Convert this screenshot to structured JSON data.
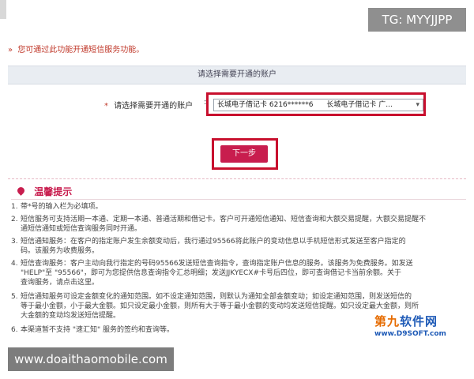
{
  "overlays": {
    "tg_badge": "TG: MYYJJPP",
    "site_badge": "www.doaithaomobile.com"
  },
  "notice": {
    "marker": "»",
    "text": "您可通过此功能开通短信服务功能。"
  },
  "section": {
    "title": "请选择需要开通的账户"
  },
  "account": {
    "required_mark": "*",
    "label": "请选择需要开通的账户",
    "colon": ":",
    "selected_card": "长城电子借记卡 6216******6",
    "selected_card_type": "长城电子借记卡 广...",
    "arrow": "▾"
  },
  "actions": {
    "next_label": "下一步"
  },
  "tips": {
    "title": "温馨提示",
    "items": [
      {
        "num": "1.",
        "text": "带*号的输入栏为必填项。"
      },
      {
        "num": "2.",
        "text": "短信服务可支持活期一本通、定期一本通、普通活期和借记卡。客户可开通短信通知、短信查询和大额交易提醒，大额交易提醒不",
        "text2": "通短信通知或短信查询服务同时开通。"
      },
      {
        "num": "3.",
        "text": "短信通知服务：在客户的指定账户发生余额变动后，我行通过95566将此账户的变动信息以手机短信形式发送至客户指定的",
        "text2": "码。该服务为收费服务。"
      },
      {
        "num": "4.",
        "text": "短信查询服务：客户主动向我行指定的号码95566发送短信查询指令，查询指定账户信息的服务。该服务为免费服务。如发送",
        "text2": "\"HELP\"至 \"95566\"，即可为您提供信息查询指令汇总明细；发送JJKYECX#卡号后四位，即可查询借记卡当前余额。关于",
        "text3": "查询服务，请点击这里。"
      },
      {
        "num": "5.",
        "text": "短信通知服务可设定金额变化的通知范围。如不设定通知范围，则默认为通知全部金额变动；如设定通知范围，则发送短信的",
        "text2": "等于最小金额，小于最大金额。如只设定最小金额，则所有大于等于最小金额的变动均发送短信提醒。如只设定最大金额，则所",
        "text3": "大金额的变动均发送短信提醒。"
      },
      {
        "num": "6.",
        "text": "本渠道暂不支持 \"速汇知\" 服务的签约和查询等。"
      }
    ]
  },
  "logo": {
    "main_orange": "第九",
    "main_blue": "软件网",
    "sub": "www.D9SOFT.com"
  },
  "colors": {
    "accent": "#c81d4e",
    "highlight_border": "#c8102e",
    "notice": "#c0392b"
  }
}
